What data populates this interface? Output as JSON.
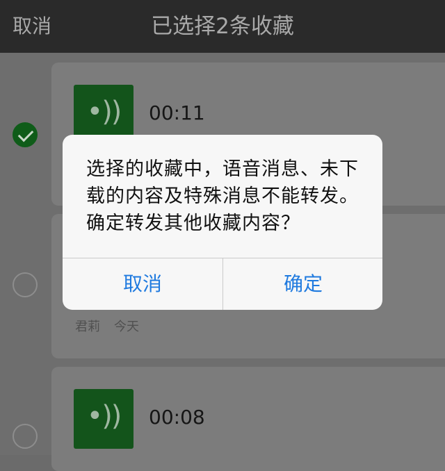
{
  "navbar": {
    "cancel_label": "取消",
    "title": "已选择2条收藏"
  },
  "favorites": [
    {
      "type": "voice",
      "duration": "00:11",
      "selected": true
    },
    {
      "type": "voice",
      "sender": "君莉",
      "time": "今天",
      "selected": false
    },
    {
      "type": "voice",
      "duration": "00:08",
      "selected": false
    }
  ],
  "voice_glyph": "•))",
  "alert": {
    "message": "选择的收藏中，语音消息、未下载的内容及特殊消息不能转发。确定转发其他收藏内容？",
    "cancel_label": "取消",
    "confirm_label": "确定"
  },
  "colors": {
    "accent_blue": "#1f7adf",
    "check_green": "#0f5c19",
    "navbar_bg": "#2a2a2a"
  }
}
